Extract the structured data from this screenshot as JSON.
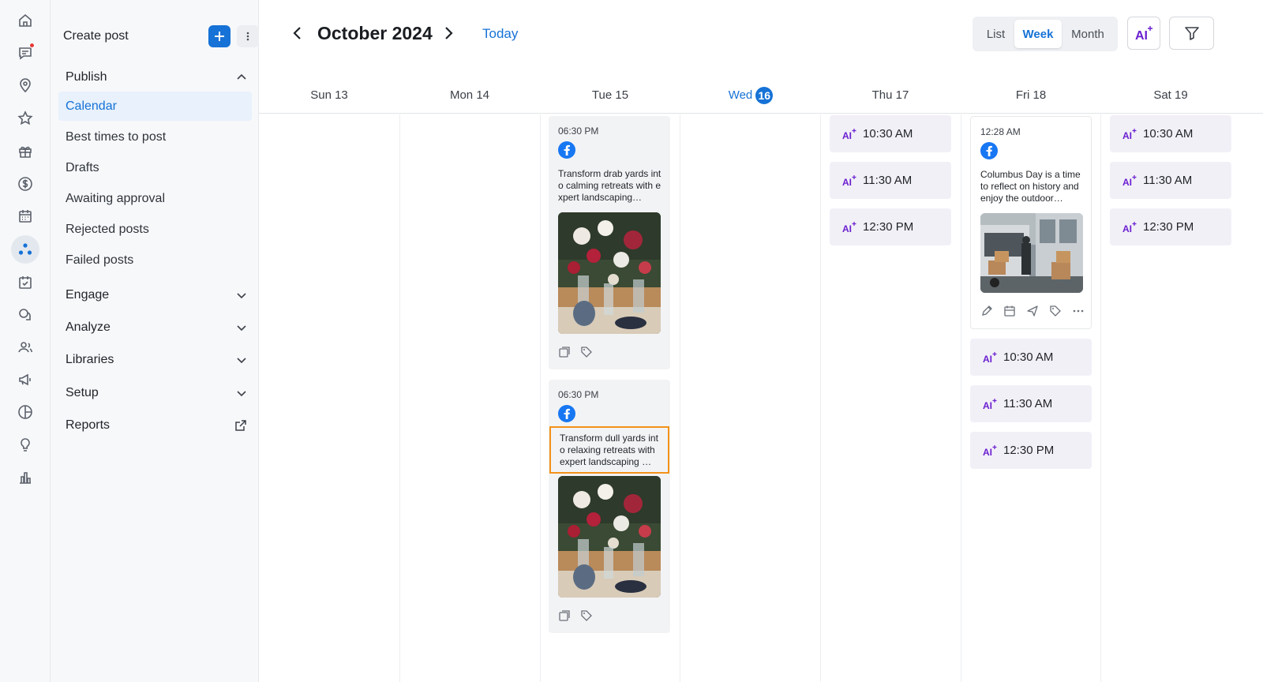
{
  "sidebar": {
    "create_label": "Create post",
    "publish": {
      "label": "Publish",
      "items": [
        "Calendar",
        "Best times to post",
        "Drafts",
        "Awaiting approval",
        "Rejected posts",
        "Failed posts"
      ]
    },
    "sections": [
      "Engage",
      "Analyze",
      "Libraries",
      "Setup"
    ],
    "reports": "Reports"
  },
  "header": {
    "title": "October 2024",
    "today": "Today",
    "views": [
      "List",
      "Week",
      "Month"
    ],
    "active_view": "Week",
    "ai_label": "AI"
  },
  "days": [
    {
      "label": "Sun 13"
    },
    {
      "label": "Mon 14"
    },
    {
      "label": "Tue 15"
    },
    {
      "label": "Wed",
      "badge": "16",
      "is_today": true
    },
    {
      "label": "Thu 17"
    },
    {
      "label": "Fri 18"
    },
    {
      "label": "Sat 19"
    }
  ],
  "posts": {
    "tue_1": {
      "time": "06:30 PM",
      "text": "Transform drab yards into calming retreats with expert landscaping…"
    },
    "tue_2": {
      "time": "06:30 PM",
      "text": "Transform dull yards into relaxing retreats with expert landscaping …"
    },
    "fri_1": {
      "time": "12:28 AM",
      "text": "Columbus Day is a time to reflect on history and enjoy the outdoor…"
    }
  },
  "ai_slots": {
    "thu": [
      "10:30 AM",
      "11:30 AM",
      "12:30 PM"
    ],
    "fri": [
      "10:30 AM",
      "11:30 AM",
      "12:30 PM"
    ],
    "sat": [
      "10:30 AM",
      "11:30 AM",
      "12:30 PM"
    ]
  },
  "colors": {
    "accent": "#1672d6",
    "ai_purple": "#6a1fd0",
    "highlight": "#f39219",
    "facebook": "#1877f2"
  }
}
